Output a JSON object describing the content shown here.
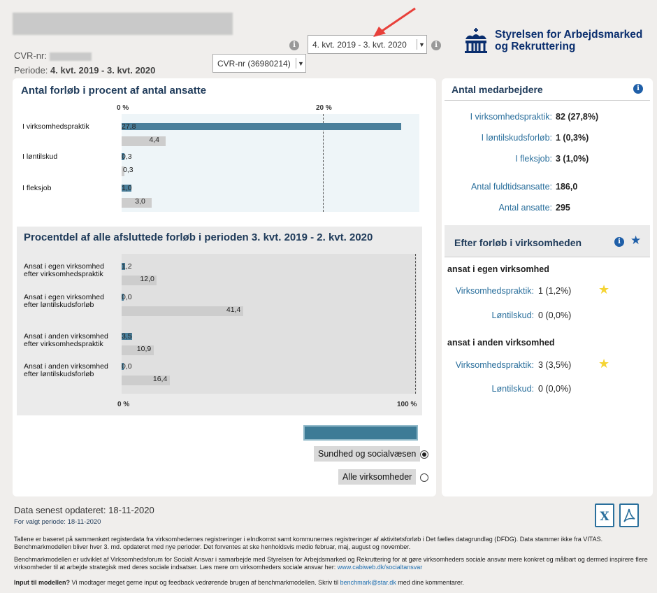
{
  "header": {
    "cvr_label": "CVR-nr:",
    "period_label": "Periode:",
    "period_value": "4. kvt. 2019 - 3. kvt. 2020",
    "period_select": "4. kvt. 2019 - 3. kvt. 2020",
    "cvr_select": "CVR-nr (36980214)",
    "logo_line1": "Styrelsen for Arbejdsmarked",
    "logo_line2": "og Rekruttering"
  },
  "chart1": {
    "title": "Antal forløb i procent af antal ansatte",
    "tick_0": "0 %",
    "tick_20": "20 %",
    "cat_1": "I virksomhedspraktik",
    "cat_2": "I løntilskud",
    "cat_3": "I fleksjob",
    "lbl_1a": "27,8",
    "lbl_1b": "4,4",
    "lbl_2a": "0,3",
    "lbl_2b": "0,3",
    "lbl_3a": "1,0",
    "lbl_3b": "3,0"
  },
  "chart2": {
    "title": "Procentdel af alle afsluttede forløb i perioden 3. kvt. 2019 - 2. kvt. 2020",
    "tick_0": "0 %",
    "tick_100": "100 %",
    "cat_1a": "Ansat i egen virksomhed",
    "cat_1b": "efter virksomhedspraktik",
    "cat_2a": "Ansat i egen virksomhed",
    "cat_2b": "efter løntilskudsforløb",
    "cat_3a": "Ansat i anden virksomhed",
    "cat_3b": "efter virksomhedspraktik",
    "cat_4a": "Ansat i anden virksomhed",
    "cat_4b": "efter løntilskudsforløb",
    "lbl_1a": "1,2",
    "lbl_1b": "12,0",
    "lbl_2a": "0,0",
    "lbl_2b": "41,4",
    "lbl_3a": "3,5",
    "lbl_3b": "10,9",
    "lbl_4a": "0,0",
    "lbl_4b": "16,4"
  },
  "chart_data": [
    {
      "type": "bar",
      "title": "Antal forløb i procent af antal ansatte",
      "categories": [
        "I virksomhedspraktik",
        "I løntilskud",
        "I fleksjob"
      ],
      "series": [
        {
          "values": [
            27.8,
            0.3,
            1.0
          ]
        },
        {
          "values": [
            4.4,
            0.3,
            3.0
          ]
        }
      ],
      "xlabel": "",
      "ylabel": "",
      "xlim": [
        0,
        28
      ]
    },
    {
      "type": "bar",
      "title": "Procentdel af alle afsluttede forløb i perioden 3. kvt. 2019 - 2. kvt. 2020",
      "categories": [
        "Ansat i egen virksomhed efter virksomhedspraktik",
        "Ansat i egen virksomhed efter løntilskudsforløb",
        "Ansat i anden virksomhed efter virksomhedspraktik",
        "Ansat i anden virksomhed efter løntilskudsforløb"
      ],
      "series": [
        {
          "values": [
            1.2,
            0.0,
            3.5,
            0.0
          ]
        },
        {
          "values": [
            12.0,
            41.4,
            10.9,
            16.4
          ]
        }
      ],
      "xlabel": "",
      "ylabel": "",
      "xlim": [
        0,
        100
      ]
    }
  ],
  "employees": {
    "title": "Antal medarbejdere",
    "r1_label": "I virksomhedspraktik:",
    "r1_value": "82 (27,8%)",
    "r2_label": "I løntilskudsforløb:",
    "r2_value": "1 (0,3%)",
    "r3_label": "I fleksjob:",
    "r3_value": "3 (1,0%)",
    "r4_label": "Antal fuldtidsansatte:",
    "r4_value": "186,0",
    "r5_label": "Antal ansatte:",
    "r5_value": "295"
  },
  "after": {
    "title": "Efter forløb i virksomheden",
    "group1": "ansat i egen virksomhed",
    "g1_r1_label": "Virksomhedspraktik:",
    "g1_r1_value": "1 (1,2%)",
    "g1_r2_label": "Løntilskud:",
    "g1_r2_value": "0 (0,0%)",
    "group2": "ansat i anden virksomhed",
    "g2_r1_label": "Virksomhedspraktik:",
    "g2_r1_value": "3 (3,5%)",
    "g2_r2_label": "Løntilskud:",
    "g2_r2_value": "0 (0,0%)"
  },
  "filters": {
    "option1": "Sundhed og socialvæsen",
    "option2": "Alle virksomheder"
  },
  "footer": {
    "updated_label": "Data senest opdateret:",
    "updated_value": "18-11-2020",
    "period_label": "For valgt periode:",
    "period_value": "18-11-2020",
    "para1": "Tallene er baseret på sammenkørt registerdata fra virksomhedernes registreringer i eIndkomst samt kommunernes registreringer af aktivitetsforløb i Det fælles datagrundlag (DFDG). Data stammer ikke fra VITAS. Benchmarkmodellen bliver hver 3. md. opdateret med nye perioder. Det forventes at ske henholdsvis medio februar, maj, august og november.",
    "para2": "Benchmarkmodellen er udviklet af Virksomhedsforum for Socialt Ansvar i samarbejde med Styrelsen for Arbejdsmarked og Rekruttering for at gøre virksomheders sociale ansvar mere konkret og målbart og dermed inspirere flere virksomheder til at arbejde strategisk med deres sociale indsatser. Læs mere om virksomheders sociale ansvar her:",
    "para2_link": "www.cabiweb.dk/socialtansvar",
    "para3_bold": "Input til modellen?",
    "para3": "Vi modtager meget gerne input og feedback vedrørende brugen af benchmarkmodellen. Skriv til",
    "para3_link": "benchmark@star.dk",
    "para3_end": "med dine kommentarer.",
    "excel_letter": "X"
  }
}
